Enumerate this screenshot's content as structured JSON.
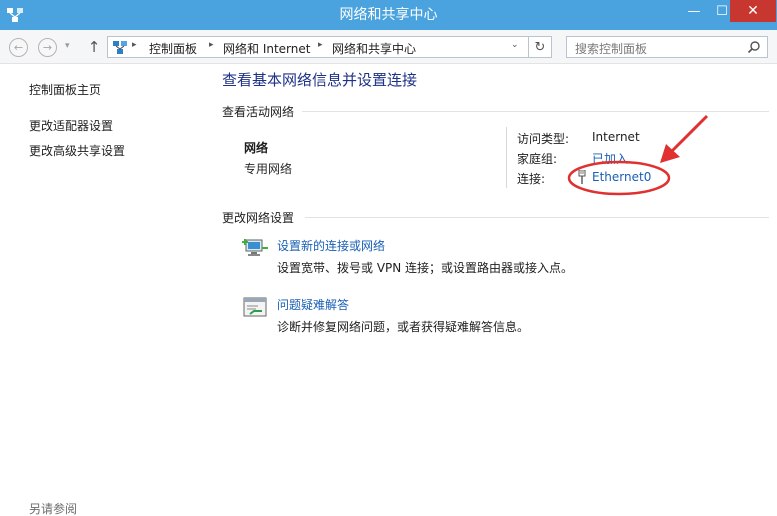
{
  "window": {
    "title": "网络和共享中心",
    "minimize_glyph": "—",
    "maximize_glyph": "☐",
    "close_glyph": "✕"
  },
  "nav": {
    "back_glyph": "←",
    "forward_glyph": "→",
    "recent_glyph": "▾",
    "up_glyph": "↑",
    "refresh_glyph": "↻",
    "breadcrumb": [
      "控制面板",
      "网络和 Internet",
      "网络和共享中心"
    ],
    "separator_glyph": "▸",
    "dropdown_glyph": "⌄"
  },
  "search": {
    "placeholder": "搜索控制面板"
  },
  "left_pane": {
    "home_link": "控制面板主页",
    "links": [
      "更改适配器设置",
      "更改高级共享设置"
    ],
    "see_also": "另请参阅"
  },
  "main": {
    "title": "查看基本网络信息并设置连接",
    "active_networks_header": "查看活动网络",
    "network": {
      "name": "网络",
      "type": "专用网络",
      "access_type_label": "访问类型:",
      "access_type_value": "Internet",
      "homegroup_label": "家庭组:",
      "homegroup_value": "已加入",
      "connection_label": "连接:",
      "connection_value": "Ethernet0"
    },
    "change_settings_header": "更改网络设置",
    "tasks": [
      {
        "title": "设置新的连接或网络",
        "description": "设置宽带、拨号或 VPN 连接；或设置路由器或接入点。",
        "icon": "network-setup-icon"
      },
      {
        "title": "问题疑难解答",
        "description": "诊断并修复网络问题，或者获得疑难解答信息。",
        "icon": "troubleshoot-icon"
      }
    ]
  },
  "colors": {
    "titlebar": "#4aa3df",
    "close_button": "#c7372f",
    "link": "#1a5fb4",
    "page_title": "#1e3287",
    "annotation": "#e03030"
  }
}
